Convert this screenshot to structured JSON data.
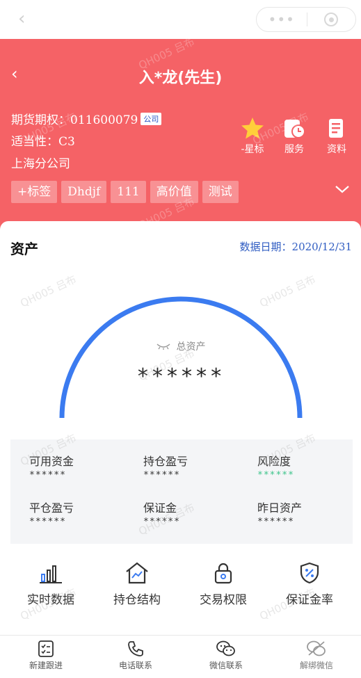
{
  "topbar": {
    "back_icon": "chevron-left-icon"
  },
  "header": {
    "title": "入*龙(先生)",
    "account_label": "期货期权：011600079",
    "account_badge": "公司",
    "suitability": "适当性：C3",
    "branch": "上海分公司",
    "actions": [
      {
        "label": "-星标",
        "icon": "star-icon"
      },
      {
        "label": "服务",
        "icon": "service-icon"
      },
      {
        "label": "资料",
        "icon": "document-icon"
      }
    ],
    "tags": [
      "+标签",
      "Dhdjf",
      "111",
      "高价值",
      "测试"
    ]
  },
  "assets": {
    "title": "资产",
    "date": "数据日期：2020/12/31",
    "total_label": "总资产",
    "total_value": "******",
    "metrics": [
      {
        "label": "可用资金",
        "value": "******"
      },
      {
        "label": "持仓盈亏",
        "value": "******"
      },
      {
        "label": "风险度",
        "value": "******"
      },
      {
        "label": "平仓盈亏",
        "value": "******"
      },
      {
        "label": "保证金",
        "value": "******"
      },
      {
        "label": "昨日资产",
        "value": "******"
      }
    ]
  },
  "quick": [
    {
      "label": "实时数据",
      "icon": "bar-chart-icon"
    },
    {
      "label": "持仓结构",
      "icon": "house-chart-icon"
    },
    {
      "label": "交易权限",
      "icon": "lock-icon"
    },
    {
      "label": "保证金率",
      "icon": "shield-percent-icon"
    }
  ],
  "tabbar": [
    {
      "label": "新建跟进",
      "icon": "checklist-icon"
    },
    {
      "label": "电话联系",
      "icon": "phone-icon"
    },
    {
      "label": "微信联系",
      "icon": "wechat-icon"
    },
    {
      "label": "解绑微信",
      "icon": "unbind-wechat-icon"
    }
  ],
  "watermark": "QH005 吕布",
  "colors": {
    "header": "#f56266",
    "accent_blue": "#3b7bf0",
    "risk_green": "#3cc48a"
  }
}
